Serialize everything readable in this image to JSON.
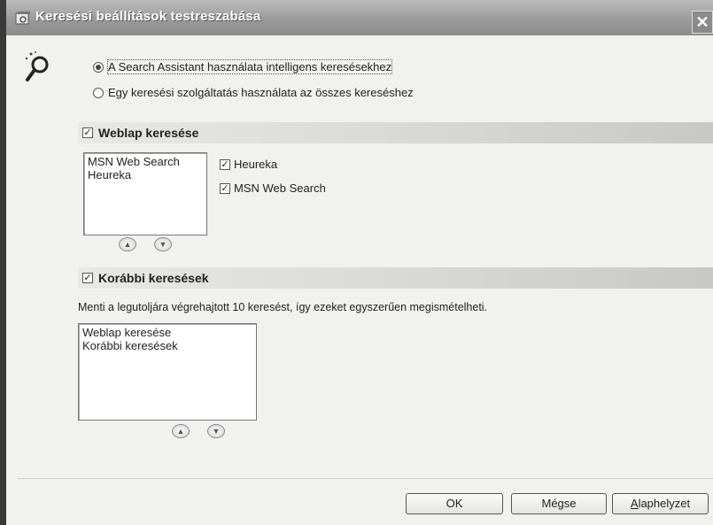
{
  "window": {
    "title": "Keresési beállítások testreszabása",
    "close_glyph": "✕"
  },
  "search_mode": {
    "options": [
      {
        "label": "A Search Assistant használata intelligens keresésekhez",
        "checked": true
      },
      {
        "label": "Egy keresési szolgáltatás használata az összes kereséshez",
        "checked": false
      }
    ]
  },
  "web_search": {
    "title": "Weblap keresése",
    "checked": true,
    "list": [
      "MSN Web Search",
      "Heureka"
    ],
    "providers": [
      {
        "label": "Heureka",
        "checked": true
      },
      {
        "label": "MSN Web Search",
        "checked": true
      }
    ],
    "up_arrow": "▲",
    "down_arrow": "▼"
  },
  "previous_searches": {
    "title": "Korábbi keresések",
    "checked": true,
    "description": "Menti a legutoljára végrehajtott 10 keresést, így ezeket egyszerűen megismételheti.",
    "list": [
      "Weblap keresése",
      "Korábbi keresések"
    ],
    "up_arrow": "▲",
    "down_arrow": "▼"
  },
  "buttons": {
    "ok": "OK",
    "cancel": "Mégse",
    "reset_first": "A",
    "reset_rest": "laphelyzet"
  },
  "icons": {
    "title": "search-window-icon",
    "assistant": "search-assistant-icon"
  },
  "colors": {
    "titlebar": "#9a9a9a",
    "section_bar": "#d6d6d2",
    "background": "#f1f1ee"
  }
}
